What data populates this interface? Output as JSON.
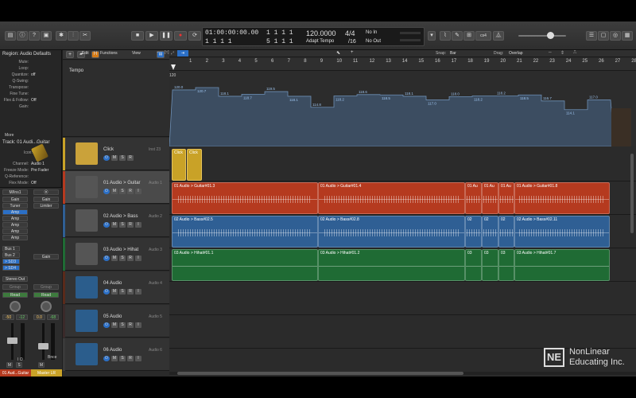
{
  "control_bar": {
    "lcd": {
      "time": "01:00:00:00.00",
      "bars_top": "1  1  1     1",
      "bars_mid": "1  1  1     1",
      "bars_sub": "1  1  1     1",
      "bars_sub2": "5  1  1     1",
      "tempo": "120.0000",
      "tempo_mode": "Adapt Tempo",
      "signature": "4/4",
      "division": "/16",
      "in_label": "No In",
      "out_label": "No Out"
    },
    "cpu_label": "cs4"
  },
  "toolbar": {
    "edit": "Edit",
    "functions": "Functions",
    "view": "View",
    "snap_label": "Snap:",
    "snap_value": "Bar",
    "drag_label": "Drag:",
    "drag_value": "Overlap"
  },
  "inspector": {
    "region_header": "Region: Audio Defaults",
    "region_rows": [
      {
        "label": "Mute:",
        "value": ""
      },
      {
        "label": "Loop:",
        "value": ""
      },
      {
        "label": "Quantize:",
        "value": "off"
      },
      {
        "label": "Q-Swing:",
        "value": ""
      },
      {
        "label": "Transpose:",
        "value": ""
      },
      {
        "label": "Fine Tune:",
        "value": ""
      },
      {
        "label": "Flex & Follow:",
        "value": "Off"
      },
      {
        "label": "Gain:",
        "value": ""
      }
    ],
    "more": "More",
    "track_header": "Track:  01 Audi...Guitar",
    "icon_label": "Icon:",
    "track_rows": [
      {
        "label": "Channel:",
        "value": "Audio 1"
      },
      {
        "label": "Freeze Mode:",
        "value": "Pre Fader"
      },
      {
        "label": "Q-Reference:",
        "value": ""
      },
      {
        "label": "Flex Mode:",
        "value": "Off"
      }
    ],
    "ch1": {
      "setting": "M/Ins1",
      "inserts": [
        "Gain",
        "Tuner",
        "Amp",
        "Amp",
        "Amp",
        "Amp",
        "Amp",
        "Gain"
      ],
      "sends": [
        "Bus 1",
        "Bus 2",
        "> SD3",
        "> SD4"
      ],
      "output": "Stereo Out",
      "group": "Group",
      "auto": "Read",
      "pan_vals": [
        "-50",
        "-12"
      ],
      "name": "01 Aud...Guitar",
      "ms": [
        "M",
        "S"
      ],
      "io": "I  O"
    },
    "ch2": {
      "inserts": [
        "Gain",
        "Limiter"
      ],
      "group": "Group",
      "auto": "Read",
      "pan_vals": [
        "0.0",
        "-68"
      ],
      "name": "Master LR",
      "bnce": "Bnce",
      "ms": [
        "M"
      ]
    }
  },
  "tracks": [
    {
      "name": "Tempo"
    },
    {
      "name": "Click",
      "num": "Inst 23",
      "btns": [
        "M",
        "S",
        "R"
      ]
    },
    {
      "name": "01 Audio > Guitar",
      "num": "Audio 1",
      "btns": [
        "M",
        "S",
        "R",
        "I"
      ]
    },
    {
      "name": "02 Audio > Bass",
      "num": "Audio 2",
      "btns": [
        "M",
        "S",
        "R",
        "I"
      ]
    },
    {
      "name": "03 Audio > Hihat",
      "num": "Audio 3",
      "btns": [
        "M",
        "S",
        "R",
        "I"
      ]
    },
    {
      "name": "04 Audio",
      "num": "Audio 4",
      "btns": [
        "M",
        "S",
        "R",
        "I"
      ]
    },
    {
      "name": "05 Audio",
      "num": "Audio 5",
      "btns": [
        "M",
        "S",
        "R",
        "I"
      ]
    },
    {
      "name": "06 Audio",
      "num": "Audio 6",
      "btns": [
        "M",
        "S",
        "R",
        "I"
      ]
    }
  ],
  "ruler": [
    "1",
    "2",
    "3",
    "4",
    "5",
    "6",
    "7",
    "8",
    "9",
    "10",
    "11",
    "12",
    "13",
    "14",
    "15",
    "16",
    "17",
    "18",
    "19",
    "20",
    "21",
    "22",
    "23",
    "24",
    "25",
    "26",
    "27",
    "28"
  ],
  "tempo_values": [
    "120.0",
    "120.7",
    "118.1",
    "118.7",
    "119.5",
    "118.1",
    "114.8",
    "118.2",
    "118.6",
    "118.5",
    "118.1",
    "117.0",
    "118.0",
    "118.2",
    "118.2",
    "118.5",
    "116.7",
    "114.1",
    "117.0"
  ],
  "tempo_axis_top": "120",
  "regions": {
    "click": [
      "Click",
      "Click"
    ],
    "guitar": [
      "01 Audio > Guitar#01.3",
      "01 Audio > Guitar#01.4",
      "01 Au",
      "01 Au",
      "01 Au",
      "01 Audio > Guitar#01.8"
    ],
    "bass": [
      "02 Audio > Bass#02.5",
      "02 Audio > Bass#02.8",
      "02",
      "02",
      "02",
      "02 Audio > Bass#02.11"
    ],
    "hihat": [
      "03 Audio > Hihat#01.1",
      "03 Audio > Hihat#01.2",
      "03",
      "03",
      "03",
      "03 Audio > Hihat#01.7"
    ]
  },
  "colors": {
    "guitar": "#b53a1f",
    "bass": "#2f5f94",
    "hihat": "#1f6b34",
    "click": "#c9a227",
    "tempo": "#3c4d61"
  },
  "watermark": {
    "ne": "NE",
    "line1": "NonLinear",
    "line2": "Educating Inc."
  }
}
